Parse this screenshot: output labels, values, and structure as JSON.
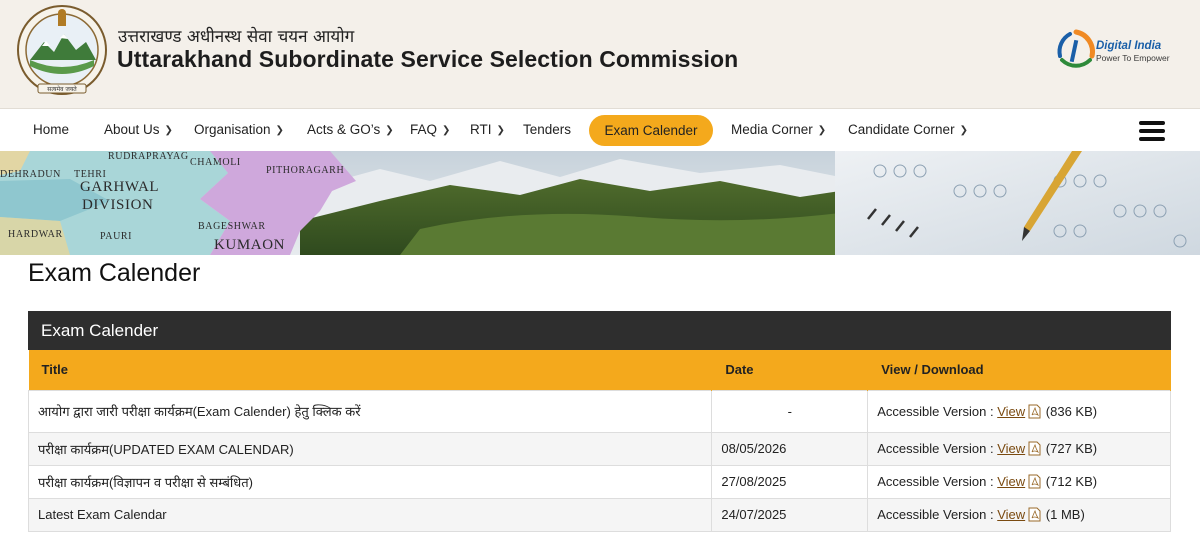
{
  "header": {
    "title_hindi": "उत्तराखण्ड अधीनस्थ सेवा चयन आयोग",
    "title_english": "Uttarakhand Subordinate Service Selection Commission",
    "digital_india": "Digital India",
    "digital_india_tagline": "Power To Empower",
    "emblem_motto": "सत्यमेव जयते"
  },
  "nav": {
    "items": [
      {
        "label": "Home",
        "has_dropdown": false
      },
      {
        "label": "About Us",
        "has_dropdown": true
      },
      {
        "label": "Organisation",
        "has_dropdown": true
      },
      {
        "label": "Acts & GO’s",
        "has_dropdown": true
      },
      {
        "label": "FAQ",
        "has_dropdown": true
      },
      {
        "label": "RTI",
        "has_dropdown": true
      },
      {
        "label": "Tenders",
        "has_dropdown": false
      },
      {
        "label": "Exam Calender",
        "has_dropdown": false,
        "active": true
      },
      {
        "label": "Media Corner",
        "has_dropdown": true
      },
      {
        "label": "Candidate Corner",
        "has_dropdown": true
      }
    ],
    "menu_icon": "hamburger-icon",
    "dropdown_icon": "chevron-down-icon",
    "active_color": "#f4a91c"
  },
  "banner": {
    "map_labels": [
      "RUDRAPRAYAG",
      "CHAMOLI",
      "DEHRADUN",
      "TEHRI",
      "GARHWAL",
      "DIVISION",
      "PITHORAGARH",
      "HARDWAR",
      "PAURI",
      "BAGESHWAR",
      "KUMAON"
    ]
  },
  "page": {
    "title": "Exam Calender"
  },
  "table": {
    "heading": "Exam Calender",
    "columns": [
      "Title",
      "Date",
      "View / Download"
    ],
    "rows": [
      {
        "title": "आयोग द्वारा जारी परीक्षा कार्यक्रम(Exam Calender) हेतु क्लिक करें",
        "date": "-",
        "access_label": "Accessible Version :",
        "view_label": "View",
        "size": "(836 KB)"
      },
      {
        "title": "परीक्षा कार्यक्रम(UPDATED EXAM CALENDAR)",
        "date": "08/05/2026",
        "access_label": "Accessible Version :",
        "view_label": "View",
        "size": "(727 KB)"
      },
      {
        "title": "परीक्षा कार्यक्रम(विज्ञापन व परीक्षा से सम्बंधित)",
        "date": "27/08/2025",
        "access_label": "Accessible Version :",
        "view_label": "View",
        "size": "(712 KB)"
      },
      {
        "title": "Latest Exam Calendar",
        "date": "24/07/2025",
        "access_label": "Accessible Version :",
        "view_label": "View",
        "size": "(1 MB)"
      }
    ],
    "header_bg": "#2e2e2e",
    "column_header_bg": "#f4a91c",
    "pdf_icon": "pdf-icon"
  }
}
